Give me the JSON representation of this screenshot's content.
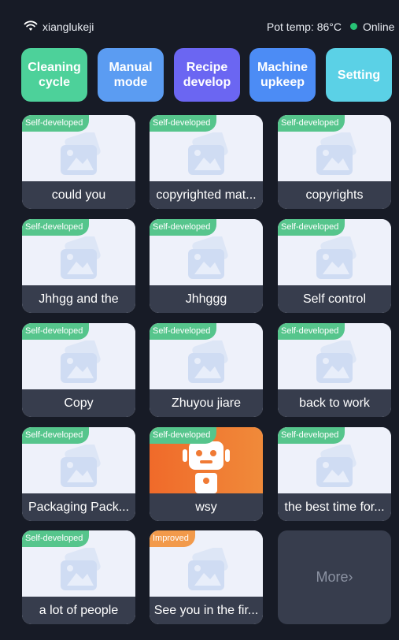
{
  "status": {
    "ssid": "xianglukeji",
    "pot_temp": "Pot temp: 86°C",
    "connection": "Online",
    "connection_color": "#27c275"
  },
  "top_buttons": [
    {
      "label": "Cleaning\ncycle",
      "color": "#4dd19a"
    },
    {
      "label": "Manual\nmode",
      "color": "#5b9cf2"
    },
    {
      "label": "Recipe\ndevelop",
      "color": "#6b66f2"
    },
    {
      "label": "Machine\nupkeep",
      "color": "#4c8cf5"
    },
    {
      "label": "Setting",
      "color": "#5bd1e6"
    }
  ],
  "recipes": [
    {
      "title": "could you",
      "badge": "Self-developed"
    },
    {
      "title": "copyrighted mat...",
      "badge": "Self-developed"
    },
    {
      "title": "copyrights",
      "badge": "Self-developed"
    },
    {
      "title": "Jhhgg and the",
      "badge": "Self-developed"
    },
    {
      "title": "Jhhggg",
      "badge": "Self-developed"
    },
    {
      "title": "Self control",
      "badge": "Self-developed"
    },
    {
      "title": "Copy",
      "badge": "Self-developed"
    },
    {
      "title": "Zhuyou jiare",
      "badge": "Self-developed"
    },
    {
      "title": "back to work",
      "badge": "Self-developed"
    },
    {
      "title": "Packaging Pack...",
      "badge": "Self-developed"
    },
    {
      "title": "wsy",
      "badge": "Self-developed"
    },
    {
      "title": "the best time for...",
      "badge": "Self-developed"
    },
    {
      "title": "a lot of people",
      "badge": "Self-developed"
    },
    {
      "title": "See you in the fir...",
      "badge": "Improved"
    }
  ],
  "more": {
    "label": "More›"
  }
}
